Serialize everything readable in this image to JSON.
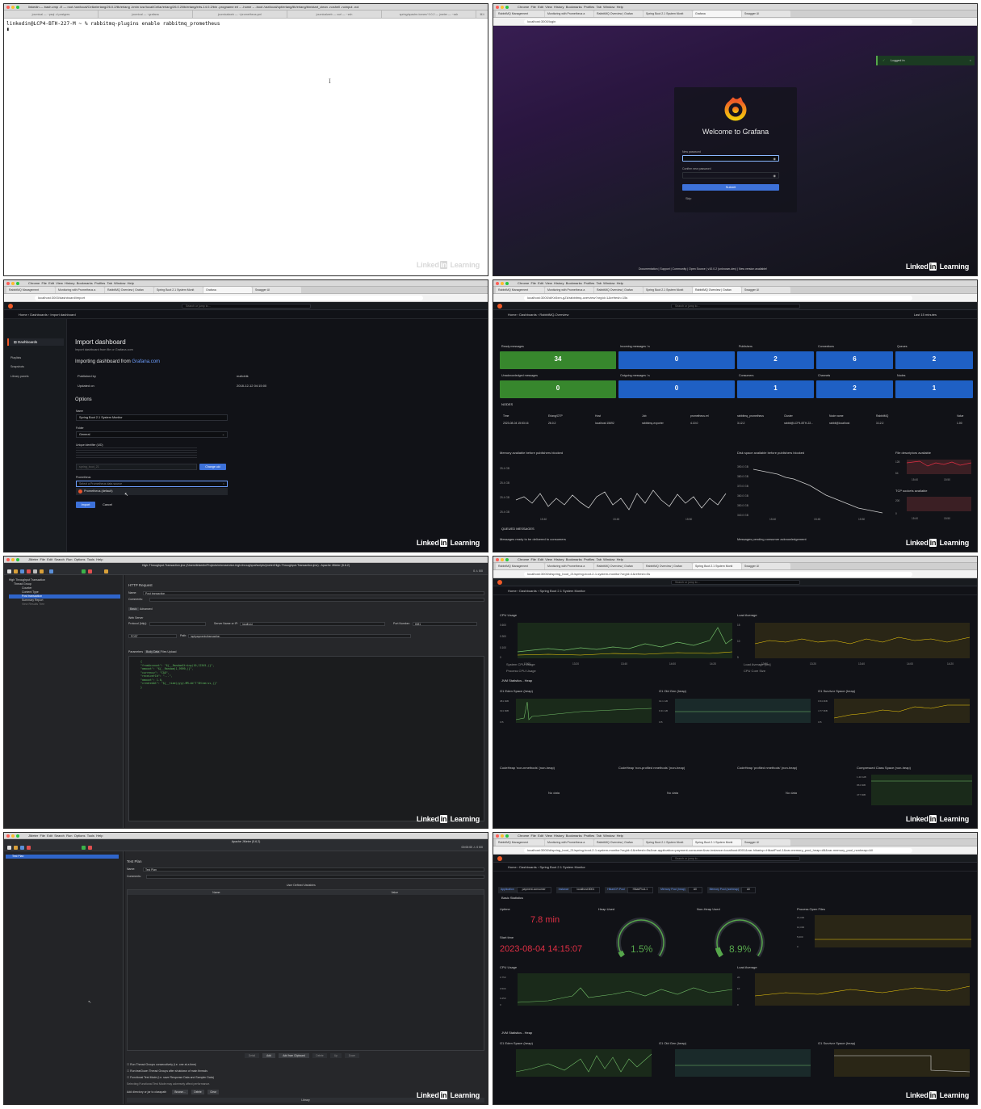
{
  "panel1": {
    "mac_title": "linkedin — bash.zmp -E — root /usr/local/Cellar/erlang/26.0.2/lib/erlang -bmin /usr/local/Cellar/erlang/26.0.2/lib/erlang/erts-14.0.2/bin -progname erl -- -home -- -boot /usr/local/opt/erlang/lib/erlang/bin/start_clean -noshell -noinput -noi",
    "tabs": [
      "journical — ~psql -d postgres",
      "journical — ~grafana",
      "journicalweb — ~/prometheus.yml",
      "journicalweb — curl — ~zsh",
      "spring/apache-tomee/ 9.0.2 — jmeter — ~zsh"
    ],
    "tab_count": "⌘4",
    "prompt": "linkedin@LCP4-BTH-227-M ~ % rabbitmq-plugins enable rabbitmq_prometheus",
    "cursor": "▮",
    "ibeam": "I",
    "watermark": "Linked in Learning"
  },
  "browser_tabs": [
    "RabbitMQ Management",
    "Monitoring with Prometheus a",
    "RabbitMQ Overview | Grafan",
    "Spring Boot 2.1 System Monit",
    "Grafana",
    "Swagger UI"
  ],
  "panel2": {
    "url": "localhost:3000/login",
    "toast": "Logged in",
    "welcome": "Welcome to Grafana",
    "new_password_label": "New password",
    "confirm_label": "Confirm new password",
    "submit": "Submit",
    "skip": "Skip",
    "footer": [
      "Documentation",
      "Support",
      "Community",
      "Open Source",
      "v10.0.2 (unknown-dev)",
      "New version available!"
    ]
  },
  "panel3": {
    "url": "localhost:3000/dashboard/import",
    "search": "Search or jump to...",
    "crumb": "Home › Dashboards › Import dashboard",
    "nav": [
      "Dashboards",
      "Playlists",
      "Snapshots",
      "Library panels"
    ],
    "title": "Import dashboard",
    "subtitle": "Import dashboard from file or Grafana.com",
    "importing_prefix": "Importing dashboard from",
    "importing_link": "Grafana.com",
    "published_by_label": "Published by",
    "published_by": "mzitohik",
    "updated_on_label": "Updated on",
    "updated_on": "2018-12-12 04:15:00",
    "options": "Options",
    "name_label": "Name",
    "name_value": "Spring Boot 2.1 System Monitor",
    "folder_label": "Folder",
    "folder_value": "General",
    "uid_label": "Unique identifier (UID)",
    "uid_value": "spring_boot_21",
    "change_uid": "Change uid",
    "prom_label": "Prometheus",
    "prom_placeholder": "Select a Prometheus data source",
    "prom_option": "Prometheus (default)",
    "import": "Import",
    "cancel": "Cancel"
  },
  "panel4": {
    "url": "localhost:3000/d/Kn5xm-gZk/rabbitmq-overview?orgId=1&refresh=15s",
    "crumb": "Home › Dashboards › RabbitMQ-Overview",
    "time": "Last 15 minutes",
    "stats": [
      {
        "title": "Ready messages",
        "value": "34",
        "color": "green"
      },
      {
        "title": "Incoming messages / s",
        "value": "0",
        "color": "blue"
      },
      {
        "title": "Publishers",
        "value": "2",
        "color": "blue"
      },
      {
        "title": "Connections",
        "value": "6",
        "color": "blue"
      },
      {
        "title": "Queues",
        "value": "2",
        "color": "blue"
      },
      {
        "title": "Unacknowledged messages",
        "value": "0",
        "color": "green"
      },
      {
        "title": "Outgoing messages / s",
        "value": "0",
        "color": "blue"
      },
      {
        "title": "Consumers",
        "value": "1",
        "color": "blue"
      },
      {
        "title": "Channels",
        "value": "2",
        "color": "blue"
      },
      {
        "title": "Nodes",
        "value": "1",
        "color": "blue"
      }
    ],
    "nodes_section": "NODES",
    "node_headers": [
      "Time",
      "Erlang/OTP",
      "Host",
      "Job",
      "prometheus.erl",
      "rabbitmq_prometheus",
      "Cluster",
      "Node name",
      "RabbitMQ",
      "Value"
    ],
    "node_row": [
      "2023-08-04 15:53:16",
      "26.0.2",
      "localhost:15692",
      "rabbitmq-exporter",
      "4.10.0",
      "3.12.2",
      "rabbit@LCP4-BTH-22...",
      "rabbit@localhost",
      "3.12.2",
      "1.00"
    ],
    "chart1": "Memory available before publishers blocked",
    "chart2": "Disk space available before publishers blocked",
    "chart3": "File descriptors available",
    "chart4": "TCP sockets available",
    "queued": "QUEUED MESSAGES",
    "q1": "Messages ready to be delivered to consumers",
    "q2": "Messages pending consumer acknowledgement"
  },
  "panel5": {
    "title": "High-Throughput-Transaction.jmx (/Users/linkedin/Projects/microservice-high-throughput/scripts/jmeter/High-Throughput-Transaction.jmx) - Apache JMeter (5.6.2)",
    "tree": [
      "High Throughput Transaction",
      "Thread Group",
      "Counter",
      "Content Type",
      "Post transaction",
      "Summary Report",
      "View Results Tree"
    ],
    "form_title": "HTTP Request",
    "name_label": "Name:",
    "name_value": "Post transaction",
    "comments": "Comments:",
    "basic": "Basic",
    "advanced": "Advanced",
    "web_server": "Web Server",
    "protocol": "Protocol [http]:",
    "server": "Server Name or IP:",
    "server_value": "localhost",
    "port": "Port Number:",
    "port_value": "8081",
    "method": "POST",
    "path_label": "Path:",
    "path_value": "/api/payments/transaction",
    "body_tabs": [
      "Parameters",
      "Body Data",
      "Files Upload"
    ],
    "body": [
      "{",
      "\"fromAccount\": \"${__RandomString(10,12345,)}\",",
      "\"amount\": \"${__Random(1,9999,)}\",",
      "\"currency\": \"CAD\",",
      "\"receiverId\": \"...\",",
      "\"amount\": 1.0,",
      "\"createdAt\": \"${__time(yyyy-MM-dd'T'HH:mm:ss,)}\"",
      "}"
    ],
    "jmeter_count": "0 ⚠ 0/0"
  },
  "panel6": {
    "url": "localhost:3000/d/spring_boot_21/spring-boot-2-1-system-monitor?orgId=1&refresh=5s",
    "crumb": "Home › Dashboards › Spring Boot 2.1 System Monitor",
    "cpu": "CPU Usage",
    "load": "Load Average",
    "jvm": "JVM Statistics - Heap",
    "eden": "G1 Eden Space (heap)",
    "old": "G1 Old Gen (heap)",
    "survivor": "G1 Survivor Space (heap)",
    "codeheap1": "CodeHeap 'non-nmethods' (non-heap)",
    "codeheap2": "CodeHeap 'non-profiled nmethods' (non-heap)",
    "codeheap3": "CodeHeap 'profiled nmethods' (non-heap)",
    "compressed": "Compressed Class Space (non-heap)",
    "nodata": "No data",
    "legend_cpu": [
      "System CPU Usage",
      "Process CPU Usage"
    ],
    "legend_load": [
      "Load Average [1m]",
      "CPU Core Size"
    ]
  },
  "panel7": {
    "title": "Apache JMeter (5.6.2)",
    "tree": [
      "Test Plan"
    ],
    "form_title": "Test Plan",
    "name_label": "Name:",
    "name_value": "Test Plan",
    "comments": "Comments:",
    "user_vars": "User Defined Variables",
    "col_name": "Name:",
    "col_value": "Value",
    "buttons": [
      "Detail",
      "Add",
      "Add from Clipboard",
      "Delete",
      "Up",
      "Down"
    ],
    "checks": [
      "Run Thread Groups consecutively (i.e. one at a time)",
      "Run tearDown Thread Groups after shutdown of main threads",
      "Functional Test Mode (i.e. save Response Data and Sampler Data)",
      "Selecting Functional Test Mode may adversely affect performance."
    ],
    "classpath": "Add directory or jar to classpath",
    "cp_buttons": [
      "Browse...",
      "Delete",
      "Clear"
    ],
    "library": "Library",
    "jmeter_count": "00:00:00 ⚠ 0 0/0"
  },
  "panel8": {
    "url": "localhost:3000/d/spring_boot_21/spring-boot-2-1-system-monitor?orgId=1&refresh=5s&var-application=payment-consumer&var-instance=localhost:8001&var-hikaricp=HikariPool-1&var-memory_pool_heap=All&var-memory_pool_nonheap=All",
    "crumb": "Home › Dashboards › Spring Boot 2.1 System Monitor",
    "vars": [
      {
        "label": "Application",
        "value": "payment-consumer"
      },
      {
        "label": "Instance",
        "value": "localhost:8001"
      },
      {
        "label": "HikariCP-Pool",
        "value": "HikariPool-1"
      },
      {
        "label": "Memory Pool (heap)",
        "value": "All"
      },
      {
        "label": "Memory Pool (nonheap)",
        "value": "All"
      }
    ],
    "basic": "Basic Statistics",
    "uptime_label": "Uptime",
    "uptime": "7.8 min",
    "start_label": "Start time",
    "start": "2023-08-04 14:15:07",
    "heap_label": "Heap Used",
    "heap": "1.5%",
    "heap_pct": 1.5,
    "nonheap_label": "Non-Heap Used",
    "nonheap": "8.9%",
    "nonheap_pct": 8.9,
    "files": "Process Open Files",
    "cpu": "CPU Usage",
    "load": "Load Average",
    "jvm": "JVM Statistics - Heap",
    "eden": "G1 Eden Space (heap)",
    "old": "G1 Old Gen (heap)",
    "survivor": "G1 Survivor Space (heap)"
  },
  "colors": {
    "grafana_bg": "#111217",
    "green": "#37872d",
    "blue": "#1f60c4",
    "gauge_green": "#56a64b",
    "red_value": "#e02f44",
    "chart_line": "#73bf69",
    "chart_line2": "#d0d0d0",
    "import_blue": "#3d71d9"
  }
}
